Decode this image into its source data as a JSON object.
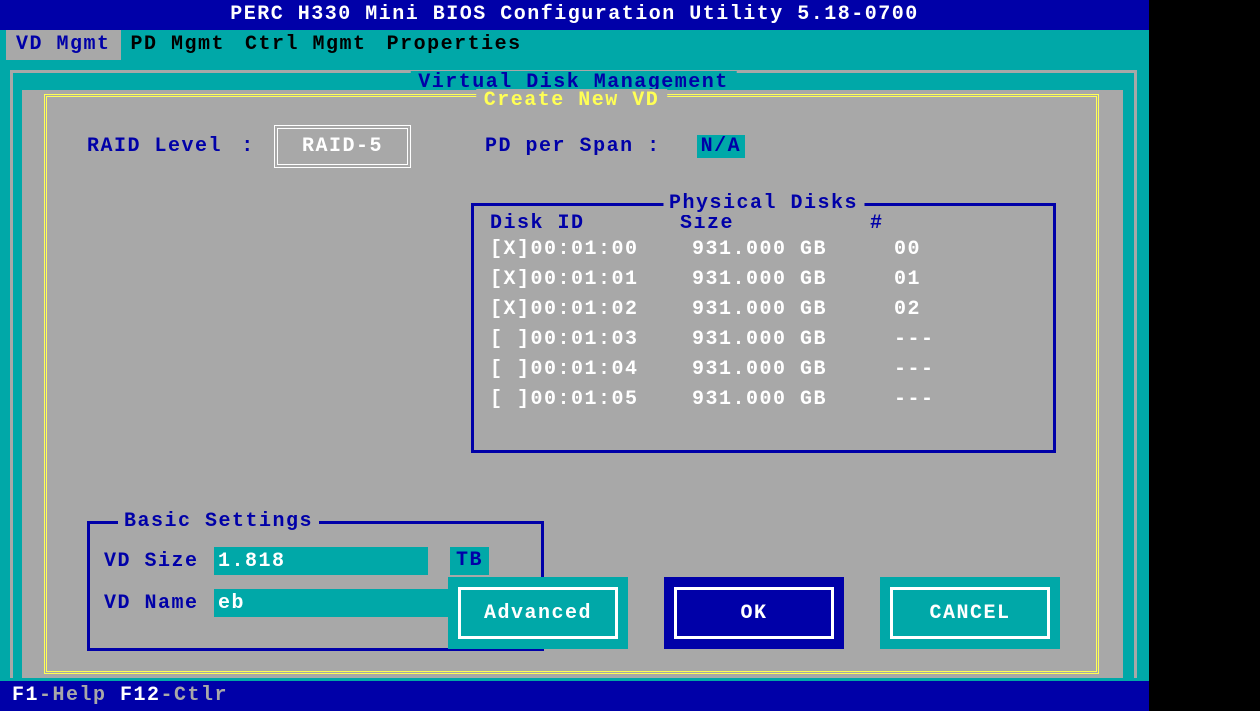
{
  "title": "PERC H330 Mini BIOS Configuration Utility 5.18-0700",
  "menu": {
    "items": [
      "VD Mgmt",
      "PD Mgmt",
      "Ctrl Mgmt",
      "Properties"
    ],
    "active_index": 0
  },
  "outer_frame_title": "Virtual Disk Management",
  "panel_title": "Create New VD",
  "raid": {
    "label": "RAID Level",
    "separator": ":",
    "value": "RAID-5"
  },
  "pd_per_span": {
    "label": "PD per Span :",
    "value": "N/A"
  },
  "physical_disks": {
    "title": "Physical Disks",
    "headers": {
      "id": "Disk ID",
      "size": "Size",
      "num": "#"
    },
    "rows": [
      {
        "sel": "[X]",
        "id": "00:01:00",
        "size": "931.000 GB",
        "num": "00"
      },
      {
        "sel": "[X]",
        "id": "00:01:01",
        "size": "931.000 GB",
        "num": "01"
      },
      {
        "sel": "[X]",
        "id": "00:01:02",
        "size": "931.000 GB",
        "num": "02"
      },
      {
        "sel": "[ ]",
        "id": "00:01:03",
        "size": "931.000 GB",
        "num": "---"
      },
      {
        "sel": "[ ]",
        "id": "00:01:04",
        "size": "931.000 GB",
        "num": "---"
      },
      {
        "sel": "[ ]",
        "id": "00:01:05",
        "size": "931.000 GB",
        "num": "---"
      }
    ]
  },
  "basic_settings": {
    "title": "Basic Settings",
    "vd_size_label": "VD Size",
    "vd_size_value": "1.818",
    "vd_size_unit": "TB",
    "vd_name_label": "VD Name",
    "vd_name_value": "eb"
  },
  "buttons": {
    "advanced": "Advanced",
    "ok": "OK",
    "cancel": "CANCEL"
  },
  "helpbar": {
    "k1": "F1",
    "t1": "-Help ",
    "k2": "F12",
    "t2": "-Ctlr"
  }
}
